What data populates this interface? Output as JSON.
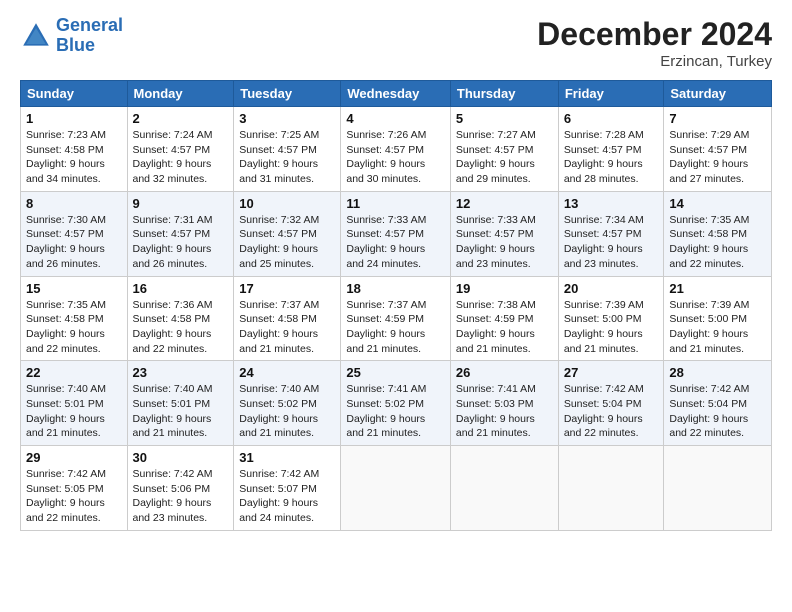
{
  "logo": {
    "line1": "General",
    "line2": "Blue"
  },
  "title": "December 2024",
  "location": "Erzincan, Turkey",
  "days_of_week": [
    "Sunday",
    "Monday",
    "Tuesday",
    "Wednesday",
    "Thursday",
    "Friday",
    "Saturday"
  ],
  "weeks": [
    [
      {
        "day": "1",
        "sunrise": "7:23 AM",
        "sunset": "4:58 PM",
        "daylight": "9 hours and 34 minutes."
      },
      {
        "day": "2",
        "sunrise": "7:24 AM",
        "sunset": "4:57 PM",
        "daylight": "9 hours and 32 minutes."
      },
      {
        "day": "3",
        "sunrise": "7:25 AM",
        "sunset": "4:57 PM",
        "daylight": "9 hours and 31 minutes."
      },
      {
        "day": "4",
        "sunrise": "7:26 AM",
        "sunset": "4:57 PM",
        "daylight": "9 hours and 30 minutes."
      },
      {
        "day": "5",
        "sunrise": "7:27 AM",
        "sunset": "4:57 PM",
        "daylight": "9 hours and 29 minutes."
      },
      {
        "day": "6",
        "sunrise": "7:28 AM",
        "sunset": "4:57 PM",
        "daylight": "9 hours and 28 minutes."
      },
      {
        "day": "7",
        "sunrise": "7:29 AM",
        "sunset": "4:57 PM",
        "daylight": "9 hours and 27 minutes."
      }
    ],
    [
      {
        "day": "8",
        "sunrise": "7:30 AM",
        "sunset": "4:57 PM",
        "daylight": "9 hours and 26 minutes."
      },
      {
        "day": "9",
        "sunrise": "7:31 AM",
        "sunset": "4:57 PM",
        "daylight": "9 hours and 26 minutes."
      },
      {
        "day": "10",
        "sunrise": "7:32 AM",
        "sunset": "4:57 PM",
        "daylight": "9 hours and 25 minutes."
      },
      {
        "day": "11",
        "sunrise": "7:33 AM",
        "sunset": "4:57 PM",
        "daylight": "9 hours and 24 minutes."
      },
      {
        "day": "12",
        "sunrise": "7:33 AM",
        "sunset": "4:57 PM",
        "daylight": "9 hours and 23 minutes."
      },
      {
        "day": "13",
        "sunrise": "7:34 AM",
        "sunset": "4:57 PM",
        "daylight": "9 hours and 23 minutes."
      },
      {
        "day": "14",
        "sunrise": "7:35 AM",
        "sunset": "4:58 PM",
        "daylight": "9 hours and 22 minutes."
      }
    ],
    [
      {
        "day": "15",
        "sunrise": "7:35 AM",
        "sunset": "4:58 PM",
        "daylight": "9 hours and 22 minutes."
      },
      {
        "day": "16",
        "sunrise": "7:36 AM",
        "sunset": "4:58 PM",
        "daylight": "9 hours and 22 minutes."
      },
      {
        "day": "17",
        "sunrise": "7:37 AM",
        "sunset": "4:58 PM",
        "daylight": "9 hours and 21 minutes."
      },
      {
        "day": "18",
        "sunrise": "7:37 AM",
        "sunset": "4:59 PM",
        "daylight": "9 hours and 21 minutes."
      },
      {
        "day": "19",
        "sunrise": "7:38 AM",
        "sunset": "4:59 PM",
        "daylight": "9 hours and 21 minutes."
      },
      {
        "day": "20",
        "sunrise": "7:39 AM",
        "sunset": "5:00 PM",
        "daylight": "9 hours and 21 minutes."
      },
      {
        "day": "21",
        "sunrise": "7:39 AM",
        "sunset": "5:00 PM",
        "daylight": "9 hours and 21 minutes."
      }
    ],
    [
      {
        "day": "22",
        "sunrise": "7:40 AM",
        "sunset": "5:01 PM",
        "daylight": "9 hours and 21 minutes."
      },
      {
        "day": "23",
        "sunrise": "7:40 AM",
        "sunset": "5:01 PM",
        "daylight": "9 hours and 21 minutes."
      },
      {
        "day": "24",
        "sunrise": "7:40 AM",
        "sunset": "5:02 PM",
        "daylight": "9 hours and 21 minutes."
      },
      {
        "day": "25",
        "sunrise": "7:41 AM",
        "sunset": "5:02 PM",
        "daylight": "9 hours and 21 minutes."
      },
      {
        "day": "26",
        "sunrise": "7:41 AM",
        "sunset": "5:03 PM",
        "daylight": "9 hours and 21 minutes."
      },
      {
        "day": "27",
        "sunrise": "7:42 AM",
        "sunset": "5:04 PM",
        "daylight": "9 hours and 22 minutes."
      },
      {
        "day": "28",
        "sunrise": "7:42 AM",
        "sunset": "5:04 PM",
        "daylight": "9 hours and 22 minutes."
      }
    ],
    [
      {
        "day": "29",
        "sunrise": "7:42 AM",
        "sunset": "5:05 PM",
        "daylight": "9 hours and 22 minutes."
      },
      {
        "day": "30",
        "sunrise": "7:42 AM",
        "sunset": "5:06 PM",
        "daylight": "9 hours and 23 minutes."
      },
      {
        "day": "31",
        "sunrise": "7:42 AM",
        "sunset": "5:07 PM",
        "daylight": "9 hours and 24 minutes."
      },
      null,
      null,
      null,
      null
    ]
  ]
}
